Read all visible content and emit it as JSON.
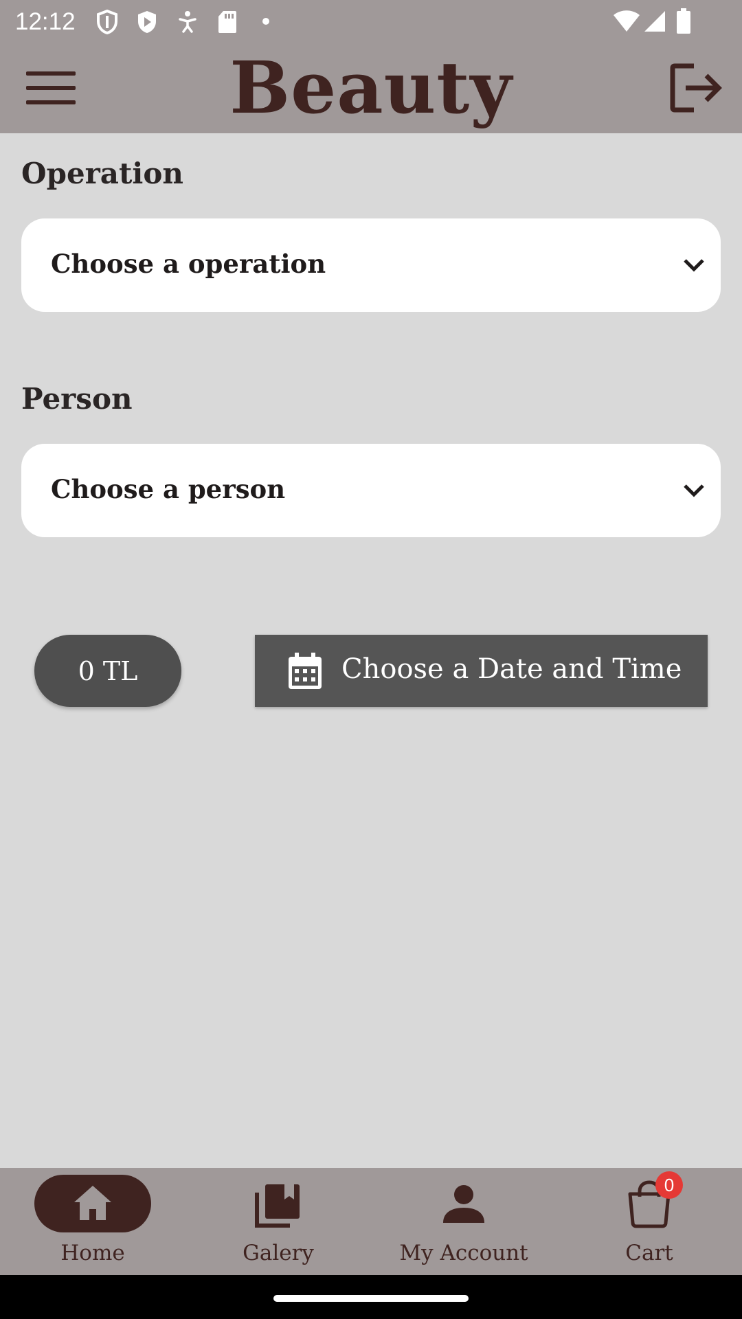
{
  "status_bar": {
    "time": "12:12",
    "icons": [
      "shield-outline-icon",
      "shield-play-icon",
      "accessibility-icon",
      "sd-card-icon",
      "dot-icon"
    ],
    "right_icons": [
      "wifi-icon",
      "cellular-signal-icon",
      "battery-icon"
    ]
  },
  "app_bar": {
    "title": "Beauty",
    "menu_icon": "menu-icon",
    "logout_icon": "logout-icon"
  },
  "operation": {
    "label": "Operation",
    "placeholder": "Choose a operation"
  },
  "person": {
    "label": "Person",
    "placeholder": "Choose a person"
  },
  "price": {
    "text": "0 TL"
  },
  "date_button": {
    "label": "Choose a Date and Time",
    "icon": "calendar-icon"
  },
  "bottom_nav": {
    "items": [
      {
        "label": "Home",
        "icon": "home-icon",
        "active": true
      },
      {
        "label": "Galery",
        "icon": "gallery-icon",
        "active": false
      },
      {
        "label": "My Account",
        "icon": "person-icon",
        "active": false
      },
      {
        "label": "Cart",
        "icon": "shopping-bag-icon",
        "active": false
      }
    ],
    "cart_badge": "0"
  },
  "colors": {
    "bar_background": "#a09999",
    "page_background": "#d9d9d9",
    "brand_brown": "#3f2320",
    "button_gray": "#555555",
    "badge_red": "#e53935"
  }
}
